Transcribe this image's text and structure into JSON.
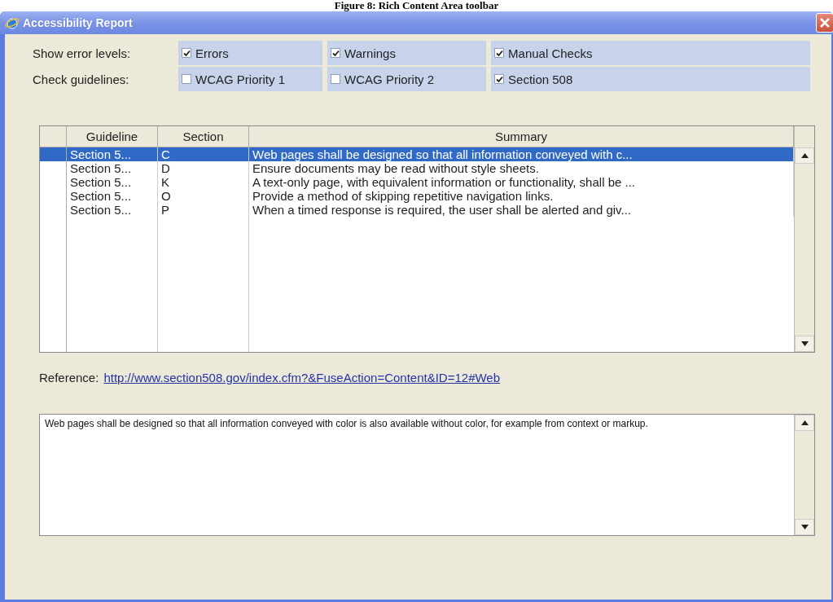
{
  "caption": "Figure 8: Rich Content Area toolbar",
  "window": {
    "title": "Accessibility Report"
  },
  "filters": [
    {
      "label": "Show error levels:",
      "options": [
        {
          "label": "Errors",
          "checked": true
        },
        {
          "label": "Warnings",
          "checked": true
        },
        {
          "label": "Manual Checks",
          "checked": true
        }
      ]
    },
    {
      "label": "Check guidelines:",
      "options": [
        {
          "label": "WCAG Priority 1",
          "checked": false
        },
        {
          "label": "WCAG Priority 2",
          "checked": false
        },
        {
          "label": "Section 508",
          "checked": true
        }
      ]
    }
  ],
  "table": {
    "columns": [
      "Guideline",
      "Section",
      "Summary"
    ],
    "rows": [
      {
        "cells": [
          "Section 5...",
          "C",
          "Web pages shall be designed so that all information conveyed with c..."
        ],
        "selected": true
      },
      {
        "cells": [
          "Section 5...",
          "D",
          "Ensure documents may be read without style sheets."
        ],
        "selected": false
      },
      {
        "cells": [
          "Section 5...",
          "K",
          "A text-only page, with equivalent information or functionality, shall be ..."
        ],
        "selected": false
      },
      {
        "cells": [
          "Section 5...",
          "O",
          "Provide a method of skipping repetitive navigation links."
        ],
        "selected": false
      },
      {
        "cells": [
          "Section 5...",
          "P",
          "When a timed response is required, the user shall be alerted and giv..."
        ],
        "selected": false
      }
    ]
  },
  "reference": {
    "label": "Reference:",
    "link": "http://www.section508.gov/index.cfm?&FuseAction=Content&ID=12#Web"
  },
  "details": {
    "text": "Web pages shall be designed so that all information conveyed with color is also available without color, for example from context or markup."
  }
}
